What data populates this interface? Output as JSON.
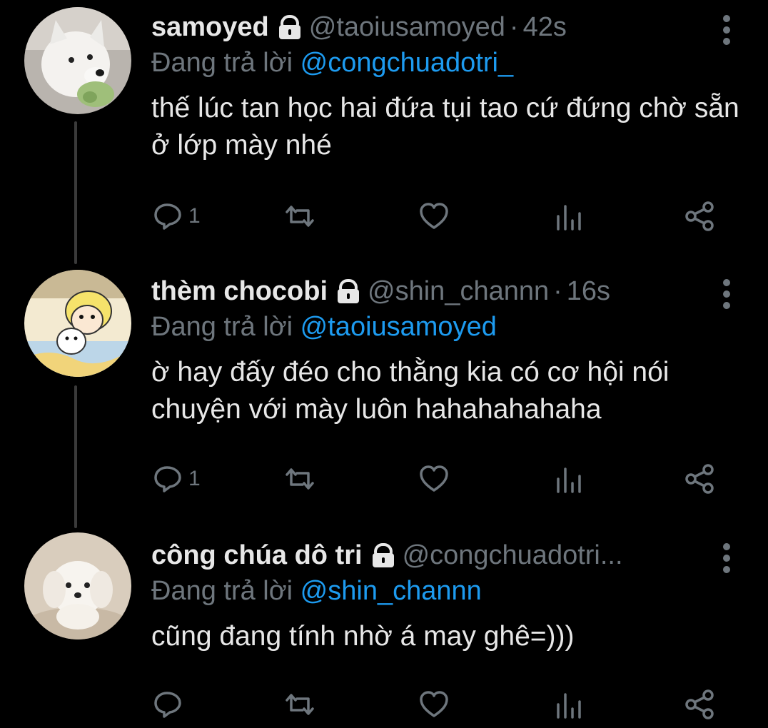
{
  "tweets": [
    {
      "display_name": "samoyed",
      "handle": "@taoiusamoyed",
      "separator": "·",
      "time": "42s",
      "replying_prefix": "Đang trả lời",
      "replying_to": "@congchuadotri_",
      "text": "thế lúc tan học hai đứa tụi tao cứ đứng chờ sẵn ở lớp mày nhé",
      "reply_count": "1"
    },
    {
      "display_name": "thèm chocobi",
      "handle": "@shin_channn",
      "separator": "·",
      "time": "16s",
      "replying_prefix": "Đang trả lời",
      "replying_to": "@taoiusamoyed",
      "text": "ờ hay đấy đéo cho thằng kia có cơ hội nói chuyện với mày luôn hahahahahaha",
      "reply_count": "1"
    },
    {
      "display_name": "công chúa dô tri",
      "handle": "@congchuadotri...",
      "separator": "",
      "time": "",
      "replying_prefix": "Đang trả lời",
      "replying_to": "@shin_channn",
      "text": "cũng đang tính nhờ á may ghê=)))",
      "reply_count": ""
    }
  ],
  "icons": {
    "lock": "lock-icon",
    "more": "more-vertical-icon",
    "reply": "reply-icon",
    "retweet": "retweet-icon",
    "like": "heart-icon",
    "analytics": "analytics-icon",
    "share": "share-icon"
  },
  "colors": {
    "background": "#000000",
    "primary_text": "#e7e7e7",
    "secondary_text": "#6e767d",
    "mention": "#1d9bf0",
    "thread_line": "#3a3a3a"
  }
}
